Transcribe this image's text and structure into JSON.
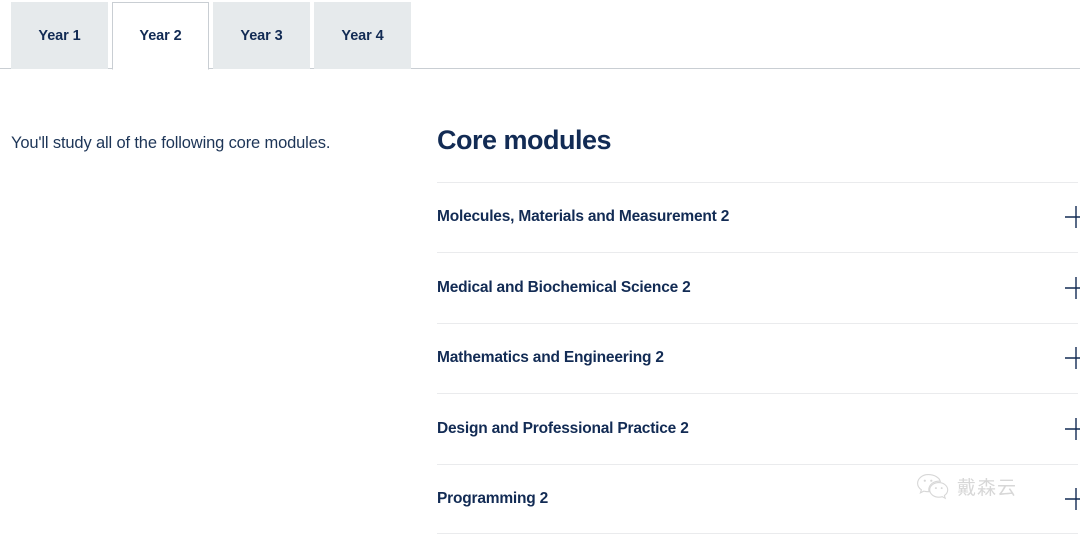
{
  "tabs": {
    "items": [
      {
        "label": "Year 1",
        "active": false
      },
      {
        "label": "Year 2",
        "active": true
      },
      {
        "label": "Year 3",
        "active": false
      },
      {
        "label": "Year 4",
        "active": false
      }
    ]
  },
  "intro": {
    "text": "You'll study all of the following core modules."
  },
  "main": {
    "heading": "Core modules",
    "modules": [
      {
        "title": "Molecules, Materials and Measurement 2",
        "toggle_icon": "plus-icon"
      },
      {
        "title": "Medical and Biochemical Science 2",
        "toggle_icon": "plus-icon"
      },
      {
        "title": "Mathematics and Engineering 2",
        "toggle_icon": "plus-icon"
      },
      {
        "title": "Design and Professional Practice 2",
        "toggle_icon": "plus-icon"
      },
      {
        "title": "Programming 2",
        "toggle_icon": "plus-icon"
      }
    ]
  },
  "watermark": {
    "icon": "wechat-icon",
    "text": "戴森云"
  },
  "colors": {
    "navy": "#122b54",
    "tab_inactive_bg": "#e6eaec",
    "tab_border": "#c9ced3",
    "divider": "#eaebed",
    "body_text": "#1d3557",
    "watermark": "#b7b7b7"
  }
}
